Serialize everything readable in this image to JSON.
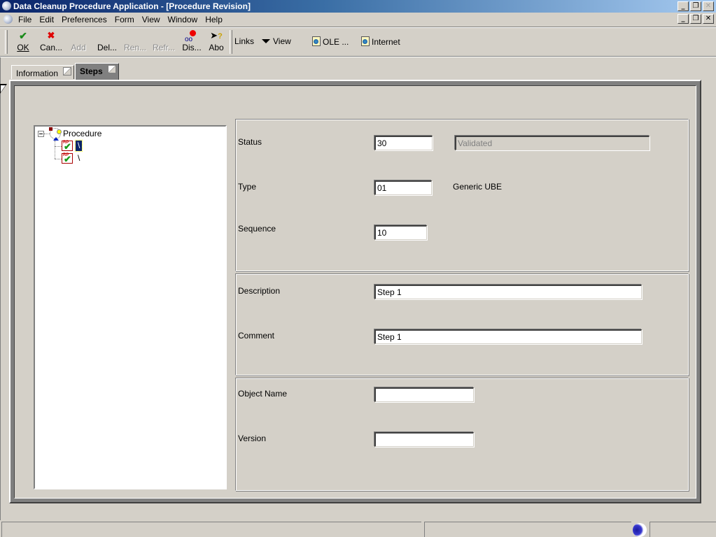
{
  "window": {
    "title": "Data Cleanup Procedure Application - [Procedure Revision]",
    "controls": {
      "minimize": "_",
      "restore": "❐",
      "close": "✕"
    }
  },
  "menu": [
    "File",
    "Edit",
    "Preferences",
    "Form",
    "View",
    "Window",
    "Help"
  ],
  "toolbar": {
    "buttons": [
      {
        "label": "OK",
        "icon": "check-icon",
        "enabled": true
      },
      {
        "label": "Can...",
        "icon": "x-icon",
        "enabled": true
      },
      {
        "label": "Add",
        "icon": "",
        "enabled": false
      },
      {
        "label": "Del...",
        "icon": "",
        "enabled": true
      },
      {
        "label": "Ren...",
        "icon": "",
        "enabled": false
      },
      {
        "label": "Refr...",
        "icon": "",
        "enabled": false
      },
      {
        "label": "Dis...",
        "icon": "glasses-icon",
        "enabled": true
      },
      {
        "label": "Abo",
        "icon": "help-pointer-icon",
        "enabled": true
      }
    ],
    "links_label": "Links",
    "view_label": "View",
    "ole_label": "OLE ...",
    "internet_label": "Internet"
  },
  "tabs": [
    {
      "label": "Information",
      "active": false
    },
    {
      "label": "Steps",
      "active": true
    }
  ],
  "tree": {
    "root": "Procedure",
    "children": [
      {
        "label": "\\",
        "selected": true
      },
      {
        "label": "\\",
        "selected": false
      }
    ]
  },
  "form": {
    "status": {
      "label": "Status",
      "value": "30",
      "description": "Validated"
    },
    "type": {
      "label": "Type",
      "value": "01",
      "description": "Generic UBE"
    },
    "sequence": {
      "label": "Sequence",
      "value": "10"
    },
    "description": {
      "label": "Description",
      "value": "Step 1"
    },
    "comment": {
      "label": "Comment",
      "value": "Step 1"
    },
    "object_name": {
      "label": "Object Name",
      "value": ""
    },
    "version": {
      "label": "Version",
      "value": ""
    }
  },
  "colors": {
    "titlebar_start": "#0a246a",
    "titlebar_end": "#a6caf0",
    "face": "#d4d0c8",
    "active_tab": "#808080"
  }
}
